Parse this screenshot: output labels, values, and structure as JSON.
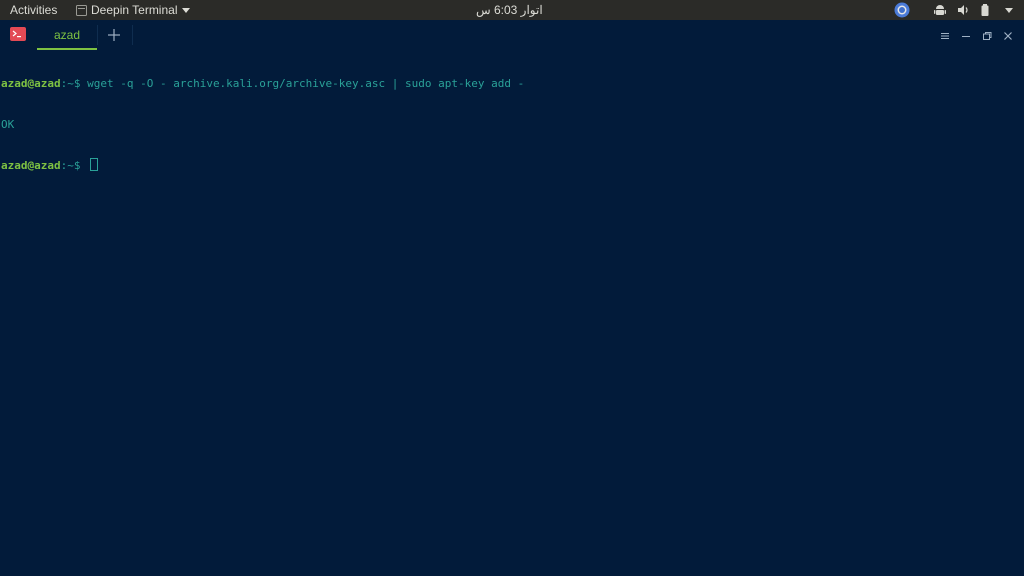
{
  "topbar": {
    "activities_label": "Activities",
    "app_menu_label": "Deepin Terminal",
    "clock": "اتوار 6:03 س",
    "tray_icons": [
      "chrome-icon",
      "android-icon",
      "volume-icon",
      "battery-icon",
      "chevron-down-icon"
    ]
  },
  "terminal_window": {
    "tab_label": "azad",
    "new_tab_icon": "plus-icon",
    "window_controls": [
      "menu-icon",
      "minimize-icon",
      "maximize-icon",
      "close-icon"
    ],
    "accent_color": "#7ec242",
    "background_color": "#021b3a"
  },
  "terminal": {
    "lines": [
      {
        "prompt_user": "azad@azad",
        "prompt_sep": ":~$ ",
        "command": "wget -q -O - archive.kali.org/archive-key.asc | sudo apt-key add -"
      },
      {
        "output": "OK"
      },
      {
        "prompt_user": "azad@azad",
        "prompt_sep": ":~$ "
      }
    ],
    "text_color": "#2aa198",
    "prompt_color": "#7ec242"
  }
}
